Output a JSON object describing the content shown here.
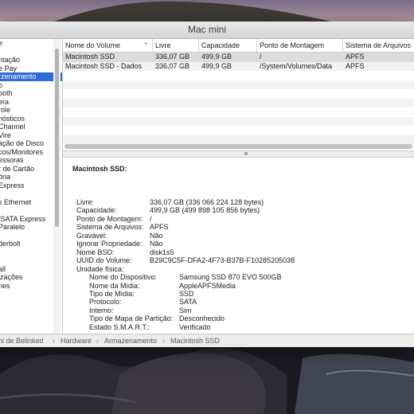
{
  "window": {
    "title": "Mac mini"
  },
  "sidebar": {
    "items": [
      {
        "label": "e"
      },
      {
        "label": ""
      },
      {
        "label": "ntação"
      },
      {
        "label": "e Pay"
      },
      {
        "label": "rzenamento",
        "selected": true
      },
      {
        "label": "o"
      },
      {
        "label": "ooth"
      },
      {
        "label": "era"
      },
      {
        "label": "role"
      },
      {
        "label": "nósticos"
      },
      {
        "label": "Channel"
      },
      {
        "label": "Vire"
      },
      {
        "label": "ação de Disco"
      },
      {
        "label": "cos/Monitores"
      },
      {
        "label": "essoras"
      },
      {
        "label": "r de Cartão"
      },
      {
        "label": "ória"
      },
      {
        "label": "Express"
      },
      {
        "label": ""
      },
      {
        "label": "s Ethernet"
      },
      {
        "label": ""
      },
      {
        "label": "/SATA Express"
      },
      {
        "label": "Paralelo"
      },
      {
        "label": ""
      },
      {
        "label": "derbolt"
      },
      {
        "label": ""
      },
      {
        "label": ""
      },
      {
        "label": "all"
      },
      {
        "label": "izações"
      },
      {
        "label": "nes"
      }
    ]
  },
  "table": {
    "columns": [
      "Nome do Volume",
      "Livre",
      "Capacidade",
      "Ponto de Montagem",
      "Sistema de Arquivos"
    ],
    "sort_icon": "chevron-up-icon",
    "rows": [
      [
        "Macintosh SSD",
        "336,07 GB",
        "499,9 GB",
        "/",
        "APFS"
      ],
      [
        "Macintosh SSD - Dados",
        "336,07 GB",
        "499,9 GB",
        "/System/Volumes/Data",
        "APFS"
      ]
    ]
  },
  "detail": {
    "title": "Macintosh SSD:",
    "fields": [
      {
        "k": "Livre:",
        "v": "336,07 GB (336 066 224 128 bytes)"
      },
      {
        "k": "Capacidade:",
        "v": "499,9 GB (499 898 105 856 bytes)"
      },
      {
        "k": "Ponto de Montagem:",
        "v": "/"
      },
      {
        "k": "Sistema de Arquivos:",
        "v": "APFS"
      },
      {
        "k": "Gravável:",
        "v": "Não"
      },
      {
        "k": "Ignorar Propriedade:",
        "v": "Não"
      },
      {
        "k": "Nome BSD:",
        "v": "disk1s5"
      },
      {
        "k": "UUID do Volume:",
        "v": "B29C9C5F-DFA2-4F73-B37B-F10285205038"
      },
      {
        "k": "Unidade física:",
        "v": ""
      }
    ],
    "physical": [
      {
        "k": "Nome do Dispositivo:",
        "v": "Samsung SSD 870 EVO 500GB"
      },
      {
        "k": "Nome da Mídia:",
        "v": "AppleAPFSMedia"
      },
      {
        "k": "Tipo de Mídia:",
        "v": "SSD"
      },
      {
        "k": "Protocolo:",
        "v": "SATA"
      },
      {
        "k": "Interno:",
        "v": "Sim"
      },
      {
        "k": "Tipo de Mapa de Partição:",
        "v": "Desconhecido"
      },
      {
        "k": "Estado S.M.A.R.T.:",
        "v": "Verificado"
      }
    ]
  },
  "breadcrumb": {
    "items": [
      "ini de Belinked",
      "Hardware",
      "Armazenamento",
      "Macintosh SSD"
    ],
    "separator": "›"
  }
}
